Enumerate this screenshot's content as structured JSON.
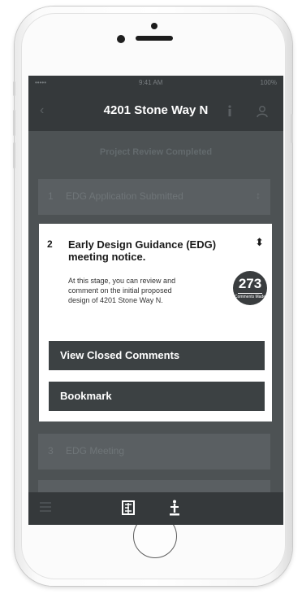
{
  "status": {
    "carrier": "•••••",
    "time": "9:41 AM",
    "battery": "100%"
  },
  "navbar": {
    "back_icon": "chevron-left-icon",
    "title": "4201 Stone Way N",
    "info_icon": "info-icon",
    "user_icon": "user-icon"
  },
  "subheader": {
    "text": "Project Review Completed"
  },
  "stages": [
    {
      "number": "1",
      "label": "EDG Application Submitted",
      "toggle": "↕"
    },
    {
      "number": "2",
      "label": "Early Design Guidance (EDG) meeting notice.",
      "toggle": "⬍"
    },
    {
      "number": "3",
      "label": "EDG Meeting",
      "toggle": ""
    }
  ],
  "card": {
    "description": "At this stage, you can review and comment on the initial proposed design of 4201 Stone Way N.",
    "badge": {
      "count": "273",
      "label": "Comments Made"
    },
    "buttons": {
      "closed_comments": "View Closed Comments",
      "bookmark": "Bookmark"
    }
  },
  "tabbar": {
    "items": [
      "menu-icon",
      "map-icon",
      "pin-icon"
    ]
  },
  "colors": {
    "screen_bg": "#4d5254",
    "bar_bg": "#35393b",
    "card_bg": "#ffffff",
    "button_bg": "#3c4143"
  }
}
